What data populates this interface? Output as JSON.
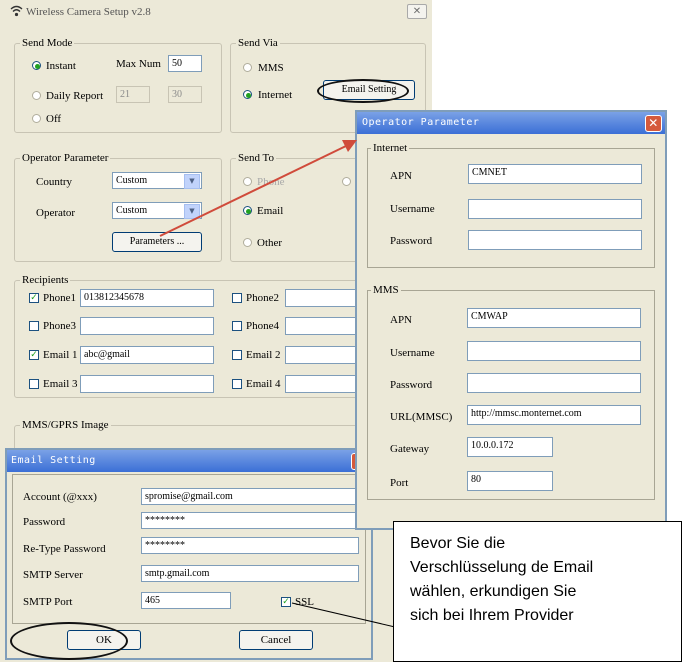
{
  "main_window": {
    "title": "Wireless Camera Setup  v2.8",
    "close_label": "✕",
    "send_mode": {
      "legend": "Send Mode",
      "instant": "Instant",
      "max_num_label": "Max Num",
      "max_num_value": "50",
      "daily_report": "Daily Report",
      "daily_a": "21",
      "daily_b": "30",
      "off": "Off"
    },
    "send_via": {
      "legend": "Send Via",
      "mms": "MMS",
      "internet": "Internet",
      "email_setting_button": "Email Setting"
    },
    "operator_parameter": {
      "legend": "Operator Parameter",
      "country_label": "Country",
      "country_value": "Custom",
      "operator_label": "Operator",
      "operator_value": "Custom",
      "parameters_button": "Parameters ..."
    },
    "send_to": {
      "legend": "Send To",
      "phone": "Phone",
      "email": "Email",
      "other": "Other"
    },
    "recipients": {
      "legend": "Recipients",
      "phone1_label": "Phone1",
      "phone1_value": "013812345678",
      "phone2_label": "Phone2",
      "phone3_label": "Phone3",
      "phone4_label": "Phone4",
      "email1_label": "Email 1",
      "email1_value": "abc@gmail",
      "email2_label": "Email 2",
      "email3_label": "Email 3",
      "email4_label": "Email 4"
    },
    "mms_gprs": {
      "legend": "MMS/GPRS Image"
    }
  },
  "operator_dialog": {
    "title": "Operator Parameter",
    "close_label": "✕",
    "internet": {
      "legend": "Internet",
      "apn_label": "APN",
      "apn_value": "CMNET",
      "username_label": "Username",
      "username_value": "",
      "password_label": "Password",
      "password_value": ""
    },
    "mms": {
      "legend": "MMS",
      "apn_label": "APN",
      "apn_value": "CMWAP",
      "username_label": "Username",
      "password_label": "Password",
      "url_label": "URL(MMSC)",
      "url_value": "http://mmsc.monternet.com",
      "gateway_label": "Gateway",
      "gateway_value": "10.0.0.172",
      "port_label": "Port",
      "port_value": "80"
    }
  },
  "email_dialog": {
    "title": "Email Setting",
    "close_label": "✕",
    "account_label": "Account (@xxx)",
    "account_value": "spromise@gmail.com",
    "password_label": "Password",
    "password_value": "********",
    "retype_label": "Re-Type Password",
    "retype_value": "********",
    "smtp_server_label": "SMTP Server",
    "smtp_server_value": "smtp.gmail.com",
    "smtp_port_label": "SMTP Port",
    "smtp_port_value": "465",
    "ssl_label": "SSL",
    "ok_button": "OK",
    "cancel_button": "Cancel"
  },
  "callout": {
    "lines": [
      "Bevor Sie die",
      "Verschlüsselung de Email",
      "wählen, erkundigen Sie",
      "sich bei Ihrem Provider"
    ]
  },
  "colors": {
    "window_bg": "#ece9d8",
    "title_blue": "#3b6fd6",
    "close_red": "#d55a3c",
    "arrow_red": "#d04b3b"
  }
}
